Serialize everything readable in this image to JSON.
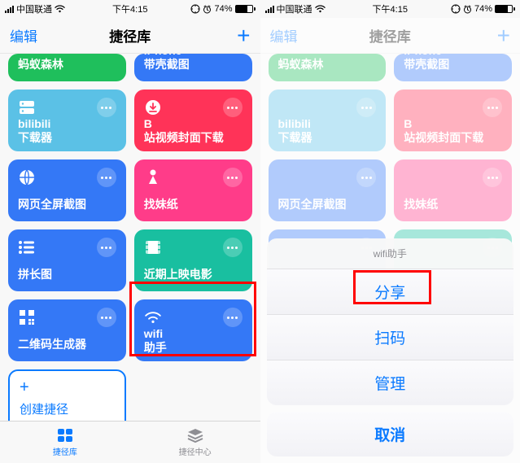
{
  "status": {
    "carrier": "中国联通",
    "time": "下午4:15",
    "battery_pct": "74%"
  },
  "nav": {
    "edit": "编辑",
    "title": "捷径库"
  },
  "tiles": {
    "t0": "蚂蚁森林",
    "t1": "iPhone\n带壳截图",
    "t2": "bilibili\n下载器",
    "t3": "B\n站视频封面下载",
    "t4": "网页全屏截图",
    "t5": "找妹纸",
    "t6": "拼长图",
    "t7": "近期上映电影",
    "t8": "二维码生成器",
    "t9": "wifi\n助手"
  },
  "new_tile": "创建捷径",
  "tabs": {
    "library": "捷径库",
    "center": "捷径中心"
  },
  "sheet": {
    "title": "wifi助手",
    "share": "分享",
    "scan": "扫码",
    "manage": "管理",
    "cancel": "取消"
  }
}
